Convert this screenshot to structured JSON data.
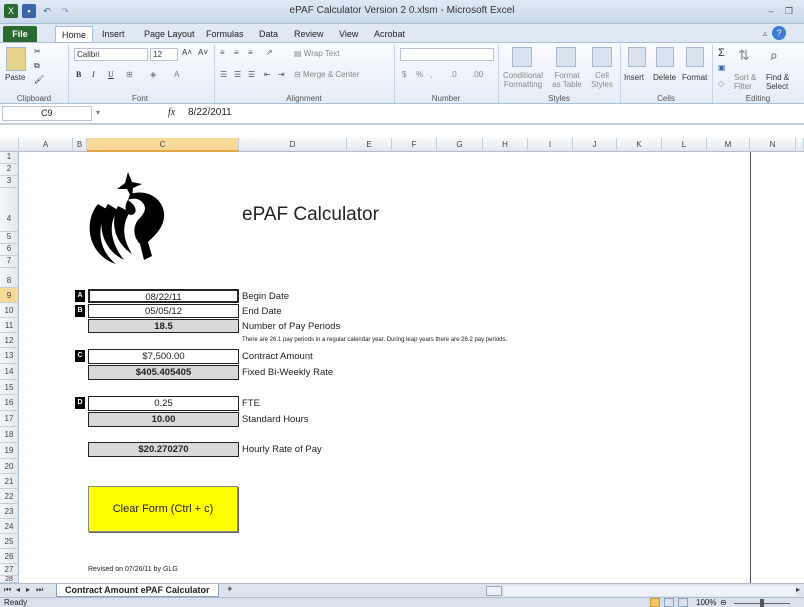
{
  "window": {
    "title": "ePAF Calculator Version 2 0.xlsm - Microsoft Excel",
    "tabs": [
      "File",
      "Home",
      "Insert",
      "Page Layout",
      "Formulas",
      "Data",
      "Review",
      "View",
      "Acrobat"
    ]
  },
  "ribbon": {
    "clipboard": {
      "label": "Clipboard",
      "paste": "Paste"
    },
    "font": {
      "label": "Font",
      "name": "Calibri",
      "size": "12",
      "bold": "B",
      "italic": "I",
      "underline": "U"
    },
    "alignment": {
      "label": "Alignment",
      "wrap_text": "Wrap Text",
      "merge_center": "Merge & Center"
    },
    "number": {
      "label": "Number",
      "currency": "$",
      "percent": "%",
      "comma": ","
    },
    "styles": {
      "label": "Styles",
      "conditional": "Conditional",
      "conditional2": "Formatting",
      "format_table": "Format",
      "format_table2": "as Table",
      "cell_styles": "Cell",
      "cell_styles2": "Styles"
    },
    "cells": {
      "label": "Cells",
      "insert": "Insert",
      "delete": "Delete",
      "format": "Format"
    },
    "editing": {
      "label": "Editing",
      "sort_filter": "Sort &",
      "sort_filter2": "Filter",
      "find_select": "Find &",
      "find_select2": "Select"
    }
  },
  "formula_bar": {
    "name_box": "C9",
    "fx": "fx",
    "value": "8/22/2011"
  },
  "columns": [
    "A",
    "B",
    "C",
    "D",
    "E",
    "F",
    "G",
    "H",
    "I",
    "J",
    "K",
    "L",
    "M",
    "N"
  ],
  "rows": [
    "1",
    "2",
    "3",
    "4",
    "5",
    "6",
    "7",
    "8",
    "9",
    "10",
    "11",
    "12",
    "13",
    "14",
    "15",
    "16",
    "17",
    "18",
    "19",
    "20",
    "21",
    "22",
    "23",
    "24",
    "25",
    "26",
    "27",
    "28"
  ],
  "sheet": {
    "title": "ePAF Calculator",
    "badge_a": "A",
    "badge_b": "B",
    "badge_c": "C",
    "badge_d": "D",
    "begin_date": "08/22/11",
    "begin_date_label": "Begin Date",
    "end_date": "05/05/12",
    "end_date_label": "End Date",
    "pay_periods": "18.5",
    "pay_periods_label": "Number of Pay Periods",
    "note": "There are 26.1 pay periods in a regular calendar year.  During leap years there are 26.2 pay periods.",
    "contract_amount": "$7,500.00",
    "contract_amount_label": "Contract Amount",
    "biweekly_rate": "$405.405405",
    "biweekly_rate_label": "Fixed Bi-Weekly Rate",
    "fte": "0.25",
    "fte_label": "FTE",
    "standard_hours": "10.00",
    "standard_hours_label": "Standard Hours",
    "hourly_rate": "$20.270270",
    "hourly_rate_label": "Hourly Rate of Pay",
    "clear_button": "Clear Form (Ctrl + c)",
    "revised": "Revised on 07/26/11 by GLG"
  },
  "sheet_tab": "Contract Amount ePAF Calculator",
  "status": {
    "ready": "Ready",
    "zoom": "100%"
  }
}
